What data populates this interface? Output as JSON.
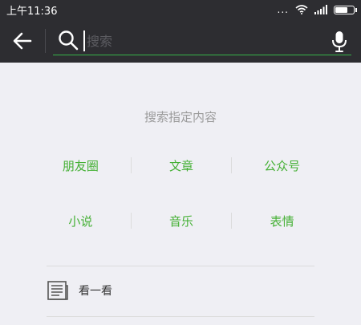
{
  "status_bar": {
    "time": "上午11:36",
    "dots": "...",
    "icons": [
      "wifi-icon",
      "signal-icon",
      "battery-icon"
    ]
  },
  "search": {
    "placeholder": "搜索",
    "value": "",
    "accent": "#37b34a",
    "icons": [
      "back-arrow-icon",
      "search-icon",
      "mic-icon"
    ]
  },
  "main": {
    "title": "搜索指定内容",
    "categories_row1": [
      "朋友圈",
      "文章",
      "公众号"
    ],
    "categories_row2": [
      "小说",
      "音乐",
      "表情"
    ],
    "category_color": "#45b035"
  },
  "kanyikan": {
    "label": "看一看",
    "icon": "newspaper-icon"
  }
}
